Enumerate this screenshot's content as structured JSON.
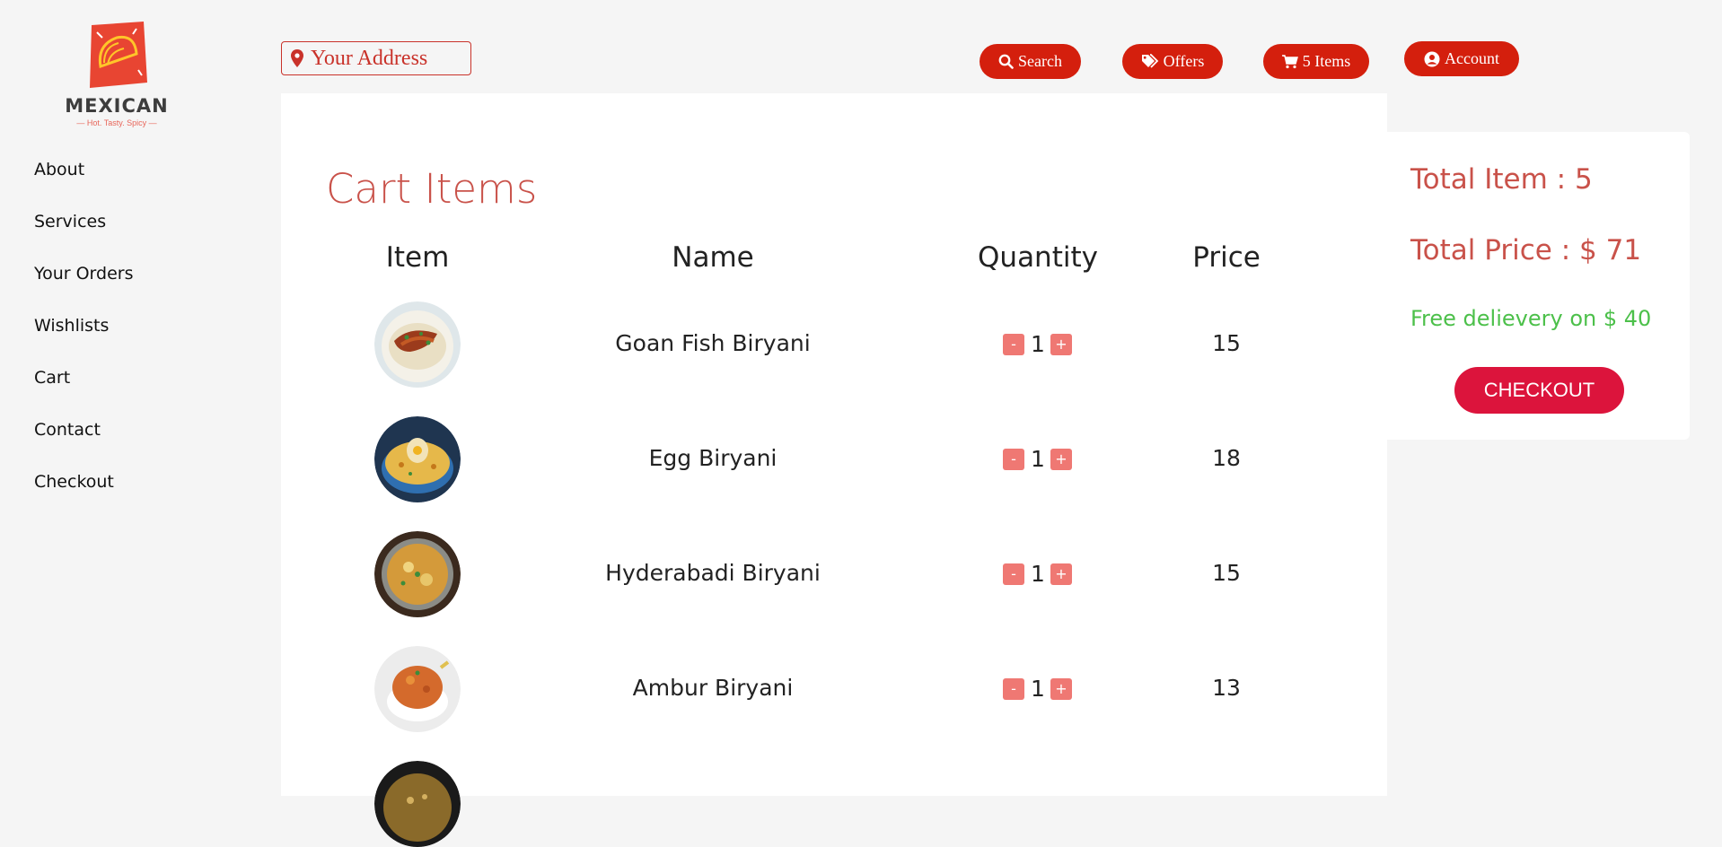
{
  "logo": {
    "word": "MEXICAN",
    "tagline": "— Hot. Tasty. Spicy —"
  },
  "sidebar": {
    "items": [
      {
        "label": "About"
      },
      {
        "label": "Services"
      },
      {
        "label": "Your Orders"
      },
      {
        "label": "Wishlists"
      },
      {
        "label": "Cart"
      },
      {
        "label": "Contact"
      },
      {
        "label": "Checkout"
      }
    ]
  },
  "header": {
    "address_label": "Your Address",
    "search_label": "Search",
    "offers_label": "Offers",
    "cart_label": "5 Items",
    "account_label": "Account"
  },
  "cart": {
    "title": "Cart Items",
    "columns": [
      "Item",
      "Name",
      "Quantity",
      "Price"
    ],
    "rows": [
      {
        "name": "Goan Fish Biryani",
        "qty": "1",
        "price": "15"
      },
      {
        "name": "Egg Biryani",
        "qty": "1",
        "price": "18"
      },
      {
        "name": "Hyderabadi Biryani",
        "qty": "1",
        "price": "15"
      },
      {
        "name": "Ambur Biryani",
        "qty": "1",
        "price": "13"
      },
      {
        "name": "",
        "qty": "",
        "price": ""
      }
    ],
    "minus_label": "-",
    "plus_label": "+"
  },
  "summary": {
    "total_item": "Total Item : 5",
    "total_price": "Total Price : $ 71",
    "free_delivery": "Free delievery on $ 40",
    "checkout_label": "CHECKOUT"
  },
  "colors": {
    "brand_red": "#d41f0d",
    "title_red": "#c9524a",
    "checkout_crimson": "#dc143c",
    "free_green": "#4cc04a"
  }
}
